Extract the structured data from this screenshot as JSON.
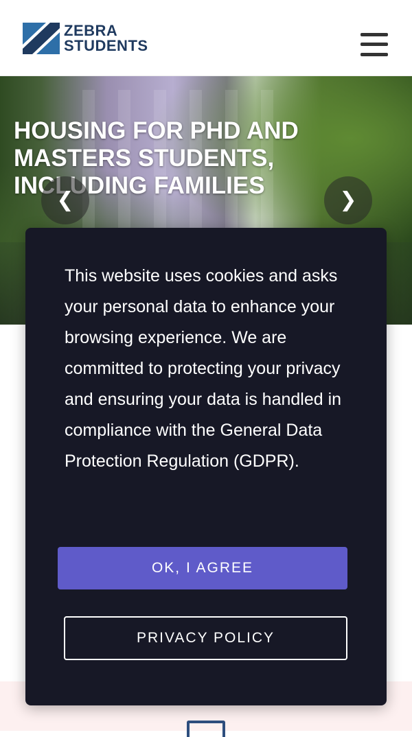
{
  "header": {
    "logo_line1": "ZEBRA",
    "logo_line2": "STUDENTS",
    "menu_icon": "hamburger-menu-icon"
  },
  "hero": {
    "title": "HOUSING FOR PHD AND MASTERS STUDENTS, INCLUDING FAMILIES",
    "prev_icon": "chevron-left-icon",
    "next_icon": "chevron-right-icon",
    "prev_glyph": "❮",
    "next_glyph": "❯"
  },
  "cookie_banner": {
    "message": "This website uses cookies and asks your personal data to enhance your browsing experience. We are committed to protecting your privacy and ensuring your data is handled in compliance with the General Data Protection Regulation (GDPR).",
    "agree_label": "OK, I AGREE",
    "privacy_label": "PRIVACY POLICY"
  },
  "colors": {
    "brand_navy": "#1f3a5f",
    "modal_background": "#171826",
    "agree_button": "#5f5bc9",
    "strip_background": "#fdf0f0"
  }
}
